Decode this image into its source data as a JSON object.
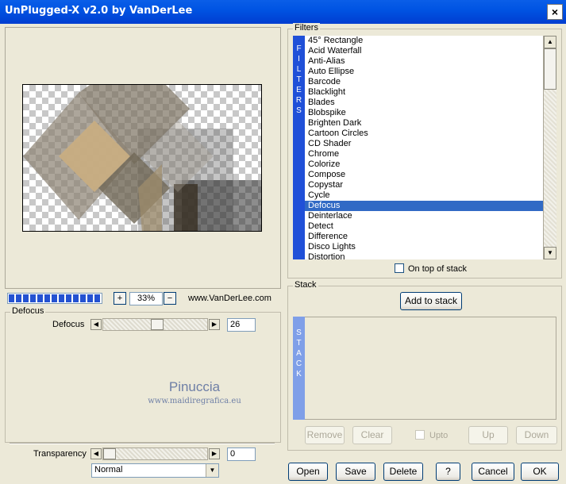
{
  "window": {
    "title": "UnPlugged-X v2.0 by VanDerLee",
    "close_label": "×"
  },
  "preview": {
    "zoom": "33%",
    "zoom_minus": "−",
    "zoom_plus": "+",
    "website": "www.VanDerLee.com",
    "progress": 1.0
  },
  "filters": {
    "group_label": "Filters",
    "vertical_label": [
      "F",
      "I",
      "L",
      "T",
      "E",
      "R",
      "S"
    ],
    "items": [
      "45° Rectangle",
      "Acid Waterfall",
      "Anti-Alias",
      "Auto Ellipse",
      "Barcode",
      "Blacklight",
      "Blades",
      "Blobspike",
      "Brighten Dark",
      "Cartoon Circles",
      "CD Shader",
      "Chrome",
      "Colorize",
      "Compose",
      "Copystar",
      "Cycle",
      "Defocus",
      "Deinterlace",
      "Detect",
      "Difference",
      "Disco Lights",
      "Distortion"
    ],
    "selected_index": 16,
    "on_top_label": "On top of stack"
  },
  "defocus": {
    "group_label": "Defocus",
    "param_label": "Defocus",
    "param_value": "26",
    "param_fraction": 0.26
  },
  "watermark": {
    "name": "Pinuccia",
    "site": "www.maidiregrafica.eu"
  },
  "transparency": {
    "label": "Transparency",
    "value": "0",
    "mode": "Normal"
  },
  "stack": {
    "group_label": "Stack",
    "add_label": "Add to stack",
    "vertical_label": [
      "S",
      "T",
      "A",
      "C",
      "K"
    ],
    "remove_label": "Remove",
    "clear_label": "Clear",
    "upto_label": "Upto",
    "up_label": "Up",
    "down_label": "Down"
  },
  "footer": {
    "open": "Open",
    "save": "Save",
    "delete": "Delete",
    "help": "?",
    "cancel": "Cancel",
    "ok": "OK"
  },
  "colors": {
    "title_bar": "#0054e3",
    "selection": "#316ac5",
    "filters_strip": "#2050d8",
    "stack_strip": "#7f9fe8"
  }
}
